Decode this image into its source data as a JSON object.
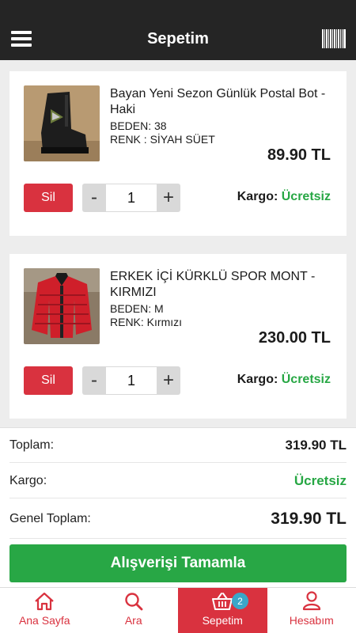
{
  "header": {
    "title": "Sepetim"
  },
  "cart": {
    "items": [
      {
        "name": "Bayan Yeni Sezon Günlük  Postal Bot -Haki",
        "beden": "BEDEN: 38",
        "renk": "RENK : SİYAH SÜET",
        "price": "89.90 TL",
        "remove_label": "Sil",
        "minus": "-",
        "plus": "+",
        "quantity": "1",
        "kargo_label": "Kargo:",
        "kargo_value": "Ücretsiz"
      },
      {
        "name": "ERKEK İÇİ KÜRKLÜ SPOR MONT  - KIRMIZI",
        "beden": "BEDEN: M",
        "renk": "RENK: Kırmızı",
        "price": "230.00 TL",
        "remove_label": "Sil",
        "minus": "-",
        "plus": "+",
        "quantity": "1",
        "kargo_label": "Kargo:",
        "kargo_value": "Ücretsiz"
      }
    ]
  },
  "summary": {
    "total_label": "Toplam:",
    "total_value": "319.90 TL",
    "shipping_label": "Kargo:",
    "shipping_value": "Ücretsiz",
    "grand_total_label": "Genel Toplam:",
    "grand_total_value": "319.90 TL",
    "checkout_label": "Alışverişi Tamamla"
  },
  "tabbar": {
    "home": "Ana Sayfa",
    "search": "Ara",
    "cart": "Sepetim",
    "cart_badge": "2",
    "account": "Hesabım"
  },
  "colors": {
    "header_bg": "#252525",
    "accent_red": "#d9323f",
    "success_green": "#28a745",
    "badge_blue": "#3aa6c9"
  },
  "icons": [
    "menu-icon",
    "barcode-icon",
    "home-icon",
    "search-icon",
    "basket-icon",
    "user-icon"
  ]
}
